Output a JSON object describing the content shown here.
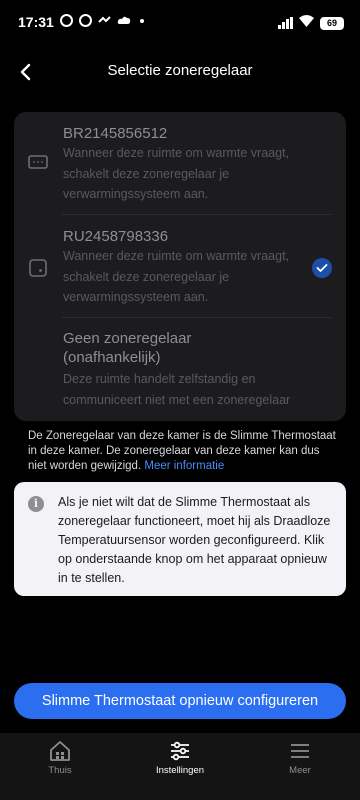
{
  "status_bar": {
    "time": "17:31",
    "battery": "69"
  },
  "header": {
    "title": "Selectie zoneregelaar"
  },
  "options": [
    {
      "title": "BR2145856512",
      "description": "Wanneer deze ruimte om warmte vraagt, schakelt deze zoneregelaar je verwarmingssysteem aan.",
      "icon": "boiler-relay-icon",
      "selected": false
    },
    {
      "title": "RU2458798336",
      "description": "Wanneer deze ruimte om warmte vraagt, schakelt deze zoneregelaar je verwarmingssysteem aan.",
      "icon": "thermostat-device-icon",
      "selected": true
    },
    {
      "title": "Geen zoneregelaar (onafhankelijk)",
      "description": "Deze ruimte handelt zelfstandig en communiceert niet met een zoneregelaar",
      "selected": false
    }
  ],
  "footnote": {
    "text": "De Zoneregelaar van deze kamer is de Slimme Thermostaat in deze kamer. De zoneregelaar van deze kamer kan dus niet worden gewijzigd.",
    "link": "Meer informatie"
  },
  "info": {
    "icon": "i",
    "text": "Als je niet wilt dat de Slimme Thermostaat als zoneregelaar functioneert, moet hij als Draadloze Temperatuursensor worden geconfigureerd. Klik op onderstaande knop om het apparaat opnieuw in te stellen."
  },
  "button": {
    "label": "Slimme Thermostaat opnieuw configureren"
  },
  "tabs": [
    {
      "label": "Thuis",
      "icon": "home-icon",
      "active": false
    },
    {
      "label": "Instellingen",
      "icon": "sliders-icon",
      "active": true
    },
    {
      "label": "Meer",
      "icon": "menu-icon",
      "active": false
    }
  ],
  "colors": {
    "accent": "#2b6ff0",
    "check": "#1e4fa8",
    "link": "#4b8cf5",
    "card": "#1c1c1e",
    "info_bg": "#f2f2f7"
  }
}
